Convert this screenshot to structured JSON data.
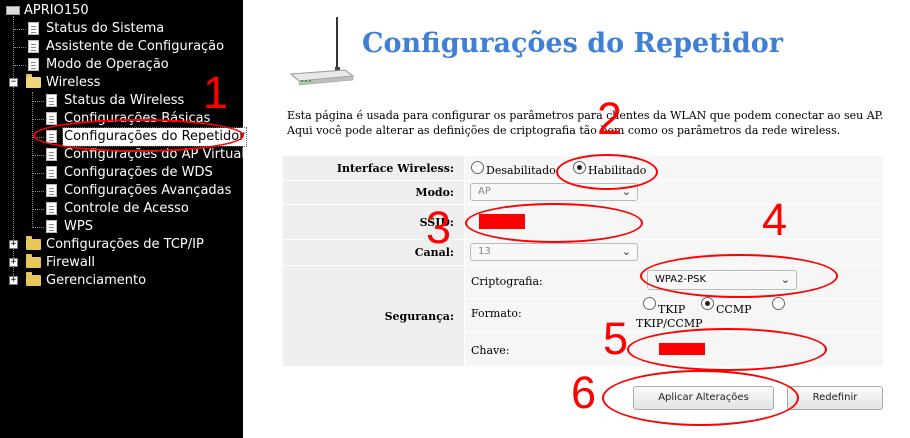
{
  "sidebar": {
    "root": "APRIO150",
    "items": [
      {
        "label": "Status do Sistema"
      },
      {
        "label": "Assistente de Configuração"
      },
      {
        "label": "Modo de Operação"
      },
      {
        "label": "Wireless"
      },
      {
        "label": "Status da Wireless"
      },
      {
        "label": "Configurações Básicas"
      },
      {
        "label": "Configurações do Repetidor"
      },
      {
        "label": "Configurações do AP Virtual"
      },
      {
        "label": "Configurações de WDS"
      },
      {
        "label": "Configurações Avançadas"
      },
      {
        "label": "Controle de Acesso"
      },
      {
        "label": "WPS"
      },
      {
        "label": "Configurações de TCP/IP"
      },
      {
        "label": "Firewall"
      },
      {
        "label": "Gerenciamento"
      }
    ]
  },
  "page": {
    "title": "Configurações do Repetidor",
    "desc_line1": "Esta página é usada para configurar os parâmetros para clientes da WLAN que podem conectar ao seu AP.",
    "desc_line2": "Aqui você pode alterar as definições de criptografia tão bem como os parâmetros da rede wireless."
  },
  "form": {
    "interface_label": "Interface Wireless:",
    "disabled_label": "Desabilitado",
    "enabled_label": "Habilitado",
    "interface_selected": "Habilitado",
    "mode_label": "Modo:",
    "mode_value": "AP",
    "ssid_label": "SSID:",
    "channel_label": "Canal:",
    "channel_value": "13",
    "security_label": "Segurança:",
    "crypto_label": "Criptografia:",
    "crypto_value": "WPA2-PSK",
    "format_label": "Formato:",
    "format_tkip": "TKIP",
    "format_ccmp": "CCMP",
    "format_both": "TKIP/CCMP",
    "format_selected": "CCMP",
    "key_label": "Chave:",
    "apply_button": "Aplicar Alterações",
    "reset_button": "Redefinir"
  },
  "annotations": [
    "1",
    "2",
    "3",
    "4",
    "5",
    "6"
  ],
  "colors": {
    "annotation": "#ff0000",
    "title": "#3f80d6",
    "sidebar_bg": "#000000"
  },
  "icons": [
    "computer-icon",
    "document-icon",
    "folder-icon",
    "folder-open-icon",
    "expand-icon",
    "collapse-icon",
    "router-image",
    "chevron-down-icon"
  ]
}
